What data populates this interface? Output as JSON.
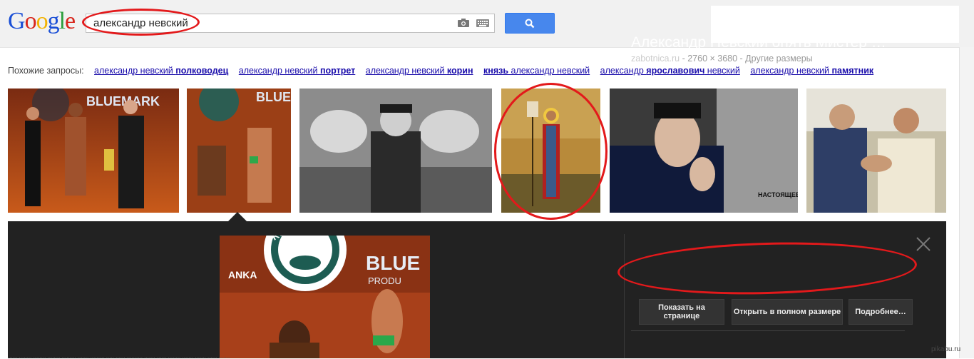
{
  "logo": {
    "letters": [
      "G",
      "o",
      "o",
      "g",
      "l",
      "e"
    ],
    "colors": [
      "#1a4fd6",
      "#d8261c",
      "#f2b304",
      "#1a4fd6",
      "#2a9d3b",
      "#d8261c"
    ]
  },
  "search": {
    "query": "александр невский"
  },
  "related": {
    "label": "Похожие запросы:",
    "items": [
      {
        "pre": "александр невский ",
        "bold": "полководец",
        "post": ""
      },
      {
        "pre": "александр невский ",
        "bold": "портрет",
        "post": ""
      },
      {
        "pre": "александр невский ",
        "bold": "корин",
        "post": ""
      },
      {
        "pre": "",
        "bold": "князь",
        "post": " александр невский"
      },
      {
        "pre": "александр ",
        "bold": "ярославович",
        "post": " невский"
      },
      {
        "pre": "александр невский ",
        "bold": "памятник",
        "post": ""
      }
    ]
  },
  "thumbs": {
    "t1": "BLUEMARK",
    "t2": "BLUE",
    "t5_caption": "НАСТОЯЩЕЕ КИНО"
  },
  "panel": {
    "title": "Александр Невский опять Мистер …",
    "site": "zabotnica.ru",
    "meta": " - 2760 × 3680 - Другие размеры",
    "btn_page": "Показать на странице",
    "btn_full": "Открыть в полном размере",
    "btn_more": "Подробнее…",
    "img_brand": "BLUE",
    "img_brand2": "PRODU",
    "img_ring": "KUPELE BRUSNO",
    "img_anka": "ANKA"
  },
  "colors": {
    "accent": "#4787ed",
    "link": "#1a0dab",
    "annotation": "#e3191b",
    "panel_bg": "#222222"
  },
  "watermark": "pikabu.ru",
  "bottom_text": "...... ........ ........ ........ ......... ....... ......... ..... ...... .......... ....... ...... ........ ....... ....... ...... ......."
}
